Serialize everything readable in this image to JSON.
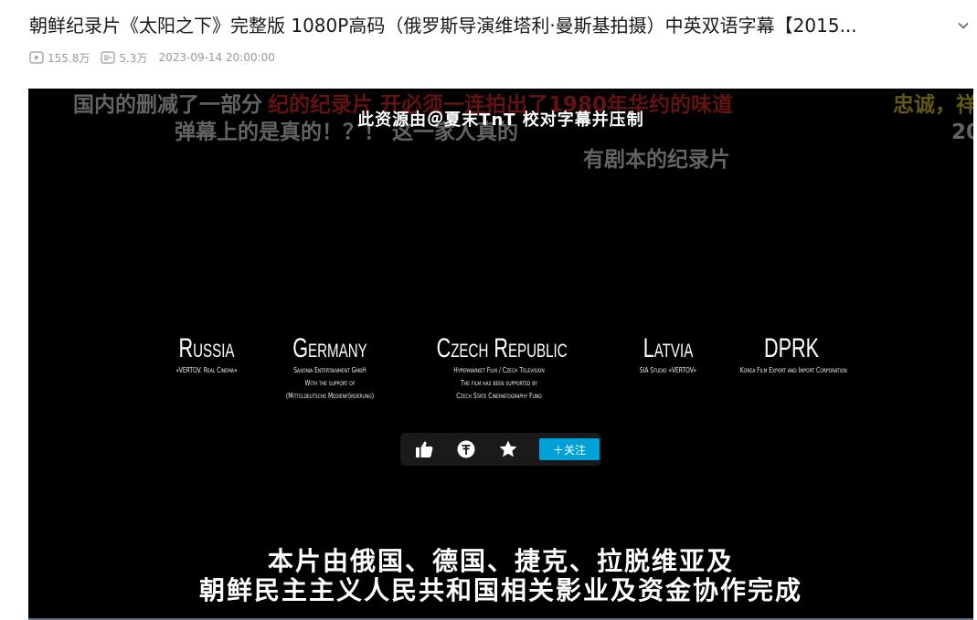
{
  "video": {
    "title": "朝鲜纪录片《太阳之下》完整版 1080P高码（俄罗斯导演维塔利·曼斯基拍摄）中英双语字幕【2015...",
    "views": "155.8万",
    "danmaku_count": "5.3万",
    "publish_time": "2023-09-14 20:00:00"
  },
  "danmaku": [
    {
      "text": "国内的删减了一部分"
    },
    {
      "text": "纪的纪录片  开必须一连拍出了1980年华约的味道"
    },
    {
      "text": "弹幕上的是真的！？！ 这一家人真的"
    },
    {
      "text": "忠诚，祥"
    },
    {
      "text": "20"
    },
    {
      "text": "有剧本的纪录片"
    }
  ],
  "caption_source": "此资源由＠夏末TnT 校对字幕并压制",
  "credits": [
    {
      "country": "Russia",
      "lines": [
        "«VERTOV. Real Cinema»"
      ]
    },
    {
      "country": "Germany",
      "lines": [
        "Saxonia Entertainment GmbH",
        "With the support of",
        "(Mitteldeutsche Medienförderung)"
      ]
    },
    {
      "country": "Czech Republic",
      "lines": [
        "Hypermarket Film / Czech Television",
        "The film has been supported by",
        "Czech State Cinematography Fund"
      ]
    },
    {
      "country": "Latvia",
      "lines": [
        "SIA Studio «VERTOV»"
      ]
    },
    {
      "country": "DPRK",
      "lines": [
        "Korea Film Export and Import Corporation"
      ]
    }
  ],
  "actions": {
    "follow_label": "＋关注"
  },
  "subtitle": {
    "line1": "本片由俄国、德国、捷克、拉脱维亚及",
    "line2": "朝鲜民主主义人民共和国相关影业及资金协作完成"
  },
  "colors": {
    "accent": "#00a1d6",
    "danmaku_red": "#8b1a1a",
    "danmaku_gray": "#8a8a8a",
    "danmaku_yellow": "#8a7a1c"
  },
  "icons": [
    "play-count-icon",
    "danmaku-count-icon",
    "chevron-down-icon",
    "like-icon",
    "coin-icon",
    "favorite-icon"
  ]
}
